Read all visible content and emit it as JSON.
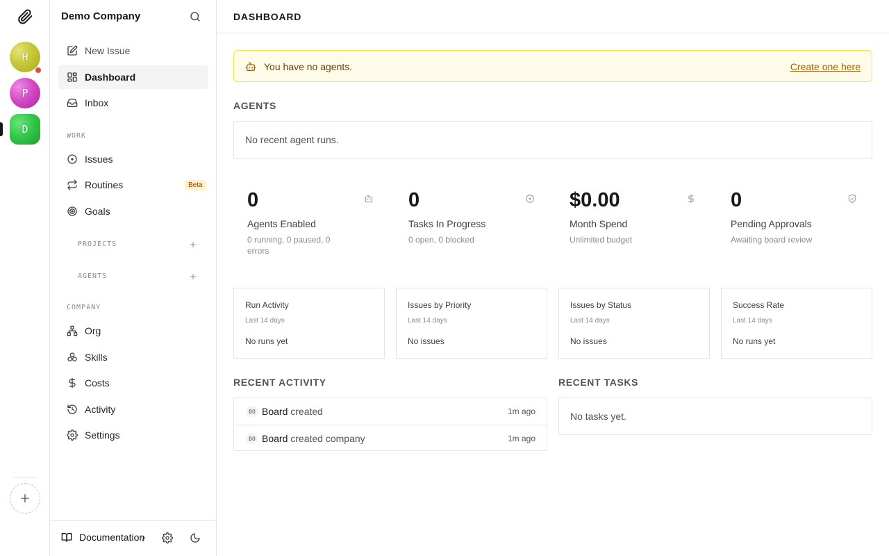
{
  "rail": {
    "companies": [
      {
        "initial": "H",
        "has_alert": true
      },
      {
        "initial": "P",
        "has_alert": false
      },
      {
        "initial": "D",
        "has_alert": false,
        "active": true
      }
    ],
    "colors": {
      "h": "#c9c93a",
      "p": "#d44bc4",
      "d": "#34c94b",
      "alert_dot": "#ef4444"
    }
  },
  "sidebar": {
    "company_name": "Demo Company",
    "top_items": [
      {
        "label": "New Issue",
        "icon": "pencil-square-icon"
      },
      {
        "label": "Dashboard",
        "icon": "dashboard-icon",
        "active": true
      },
      {
        "label": "Inbox",
        "icon": "inbox-icon"
      }
    ],
    "work_label": "WORK",
    "work_items": [
      {
        "label": "Issues",
        "icon": "circle-dot-icon"
      },
      {
        "label": "Routines",
        "icon": "repeat-icon",
        "badge": "Beta"
      },
      {
        "label": "Goals",
        "icon": "target-icon"
      }
    ],
    "projects_label": "PROJECTS",
    "agents_label": "AGENTS",
    "company_label": "COMPANY",
    "company_items": [
      {
        "label": "Org",
        "icon": "org-chart-icon"
      },
      {
        "label": "Skills",
        "icon": "boxes-icon"
      },
      {
        "label": "Costs",
        "icon": "dollar-icon"
      },
      {
        "label": "Activity",
        "icon": "history-icon"
      },
      {
        "label": "Settings",
        "icon": "gear-icon"
      }
    ],
    "footer": {
      "documentation": "Documentation",
      "version": "v"
    }
  },
  "header": {
    "breadcrumb": "DASHBOARD"
  },
  "alert": {
    "text": "You have no agents.",
    "link": "Create one here",
    "colors": {
      "bg": "#fefce8",
      "border": "#fde047",
      "text": "#713f12"
    }
  },
  "agents": {
    "title": "AGENTS",
    "empty": "No recent agent runs."
  },
  "stats": [
    {
      "value": "0",
      "label": "Agents Enabled",
      "sub": "0 running, 0 paused, 0 errors",
      "icon": "bot-icon"
    },
    {
      "value": "0",
      "label": "Tasks In Progress",
      "sub": "0 open, 0 blocked",
      "icon": "circle-dot-icon"
    },
    {
      "value": "$0.00",
      "label": "Month Spend",
      "sub": "Unlimited budget",
      "icon": "dollar-icon"
    },
    {
      "value": "0",
      "label": "Pending Approvals",
      "sub": "Awaiting board review",
      "icon": "shield-check-icon"
    }
  ],
  "mini_charts": [
    {
      "title": "Run Activity",
      "range": "Last 14 days",
      "empty": "No runs yet"
    },
    {
      "title": "Issues by Priority",
      "range": "Last 14 days",
      "empty": "No issues"
    },
    {
      "title": "Issues by Status",
      "range": "Last 14 days",
      "empty": "No issues"
    },
    {
      "title": "Success Rate",
      "range": "Last 14 days",
      "empty": "No runs yet"
    }
  ],
  "recent_activity": {
    "title": "RECENT ACTIVITY",
    "rows": [
      {
        "avatar": "BO",
        "actor": "Board",
        "action": "created",
        "time": "1m ago"
      },
      {
        "avatar": "BO",
        "actor": "Board",
        "action": "created company",
        "time": "1m ago"
      }
    ]
  },
  "recent_tasks": {
    "title": "RECENT TASKS",
    "empty": "No tasks yet."
  }
}
